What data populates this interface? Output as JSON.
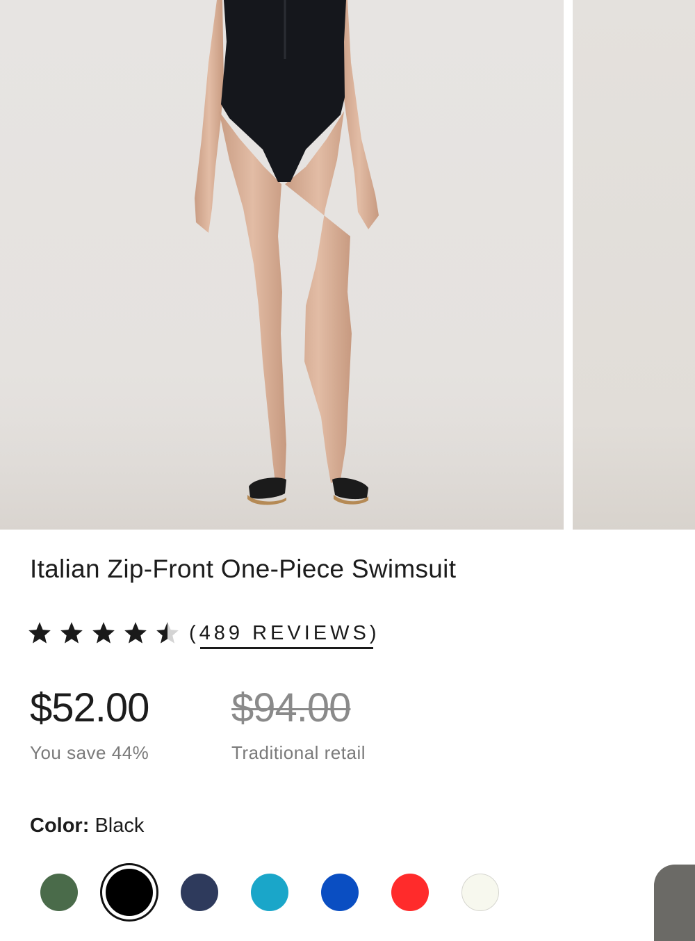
{
  "product": {
    "title": "Italian Zip-Front One-Piece Swimsuit",
    "rating": {
      "stars": 4.5,
      "max": 5,
      "reviews_text": "(489 REVIEWS)"
    },
    "price": {
      "sale": "$52.00",
      "sale_note": "You save 44%",
      "retail": "$94.00",
      "retail_note": "Traditional retail"
    },
    "color": {
      "label": "Color:",
      "selected": "Black",
      "swatches": [
        {
          "name": "green",
          "hex": "#4a6b4a"
        },
        {
          "name": "black",
          "hex": "#000000",
          "selected": true
        },
        {
          "name": "navy",
          "hex": "#2e3a5c"
        },
        {
          "name": "turquoise",
          "hex": "#1aa6c9"
        },
        {
          "name": "royal-blue",
          "hex": "#0a4ec2"
        },
        {
          "name": "red",
          "hex": "#ff2b2b"
        },
        {
          "name": "ivory",
          "hex": "#f7f8ee"
        }
      ]
    }
  },
  "colors": {
    "text": "#1c1c1c",
    "muted": "#7a7a7a",
    "photo_bg": "#e6e3e0"
  },
  "icons": {
    "star": "star-icon",
    "half_star": "half-star-icon"
  }
}
